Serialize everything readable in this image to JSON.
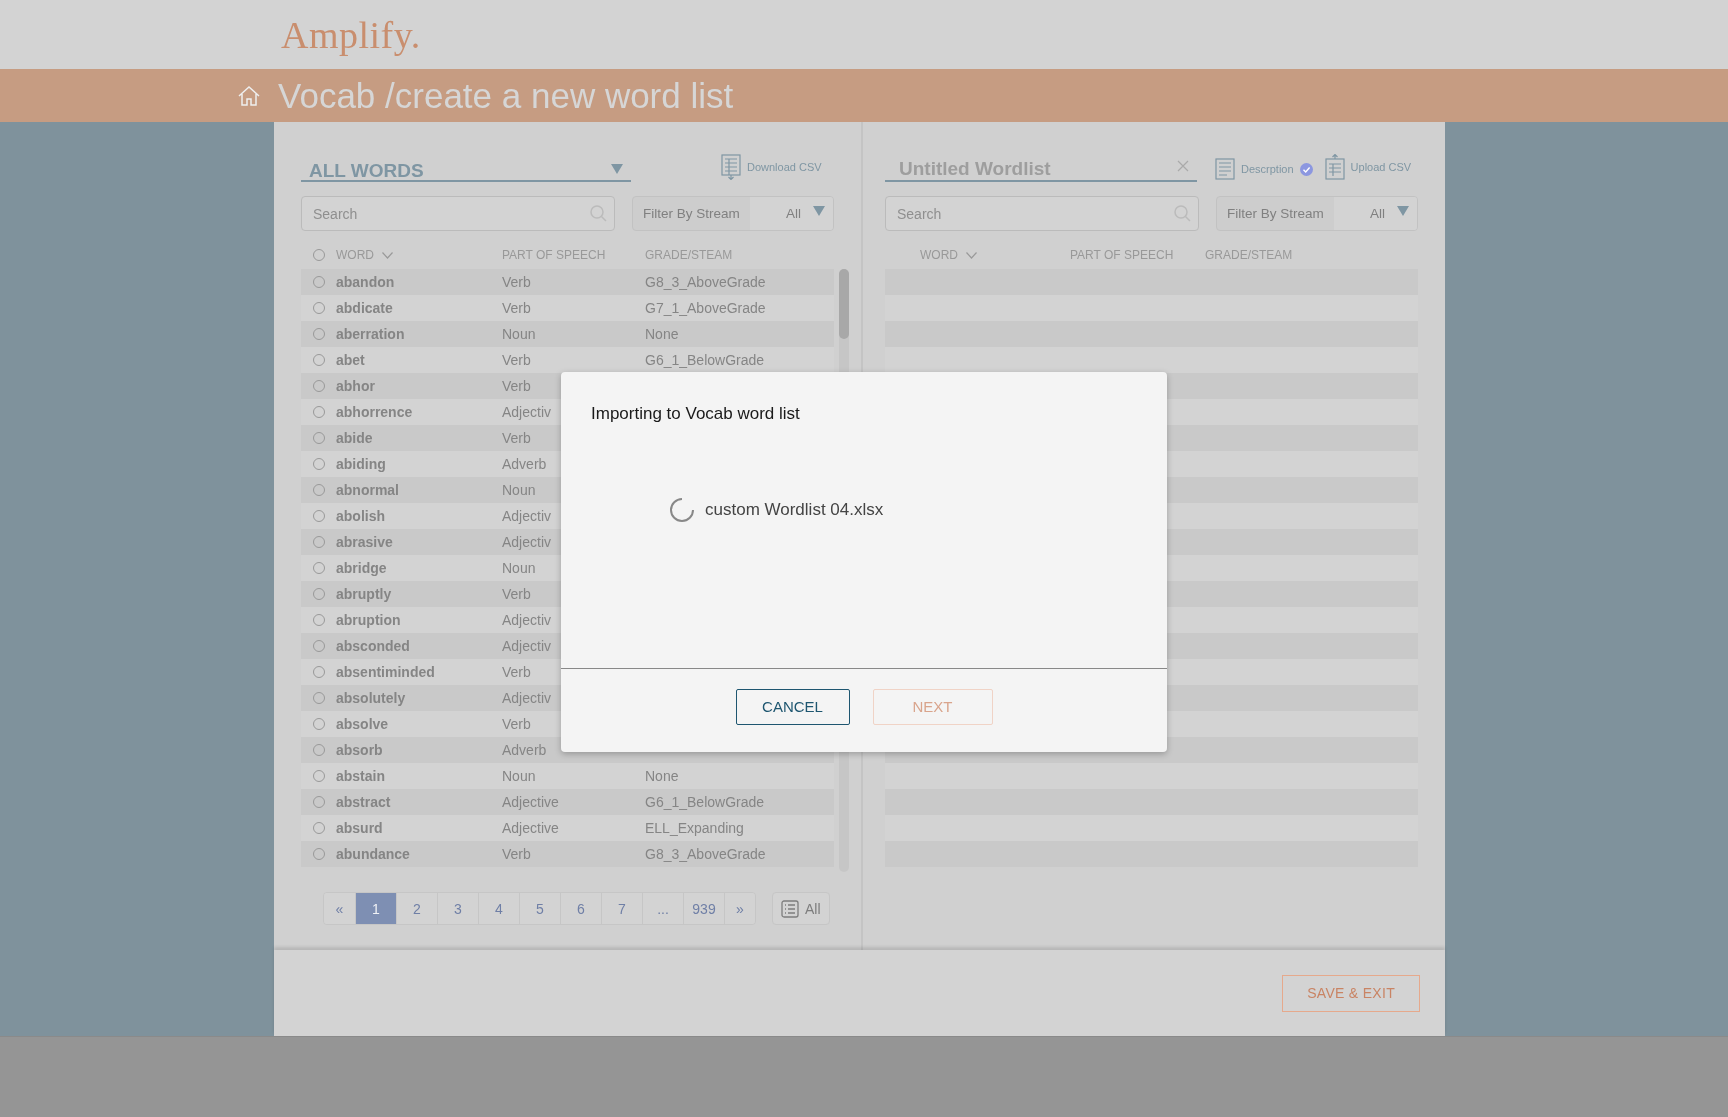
{
  "header": {
    "logo": "Amplify.",
    "breadcrumb": "Vocab /create a new word list"
  },
  "left_panel": {
    "list_selector": "ALL WORDS",
    "download": "Download CSV",
    "search": {
      "placeholder": "Search"
    },
    "filter": {
      "label": "Filter By Stream",
      "value": "All"
    },
    "select_all": {
      "selected": false
    },
    "columns": [
      "WORD",
      "PART OF SPEECH",
      "GRADE/STEAM"
    ],
    "rows": [
      {
        "word": "abandon",
        "part_of_speech": "Verb",
        "grade": "G8_3_AboveGrade",
        "selected": false
      },
      {
        "word": "abdicate",
        "part_of_speech": "Verb",
        "grade": "G7_1_AboveGrade",
        "selected": false
      },
      {
        "word": "aberration",
        "part_of_speech": "Noun",
        "grade": "None",
        "selected": false
      },
      {
        "word": "abet",
        "part_of_speech": "Verb",
        "grade": "G6_1_BelowGrade",
        "selected": false
      },
      {
        "word": "abhor",
        "part_of_speech": "Verb",
        "selected": false
      },
      {
        "word": "abhorrence",
        "part_of_speech": "Adjectiv",
        "selected": false
      },
      {
        "word": "abide",
        "part_of_speech": "Verb",
        "selected": false
      },
      {
        "word": "abiding",
        "part_of_speech": "Adverb",
        "selected": false
      },
      {
        "word": "abnormal",
        "part_of_speech": "Noun",
        "selected": false
      },
      {
        "word": "abolish",
        "part_of_speech": "Adjectiv",
        "selected": false
      },
      {
        "word": "abrasive",
        "part_of_speech": "Adjectiv",
        "selected": false
      },
      {
        "word": "abridge",
        "part_of_speech": "Noun",
        "selected": false
      },
      {
        "word": "abruptly",
        "part_of_speech": "Verb",
        "selected": false
      },
      {
        "word": "abruption",
        "part_of_speech": "Adjectiv",
        "selected": false
      },
      {
        "word": "absconded",
        "part_of_speech": "Adjectiv",
        "selected": false
      },
      {
        "word": "absentiminded",
        "part_of_speech": "Verb",
        "selected": false
      },
      {
        "word": "absolutely",
        "part_of_speech": "Adjectiv",
        "selected": false
      },
      {
        "word": "absolve",
        "part_of_speech": "Verb",
        "selected": false
      },
      {
        "word": "absorb",
        "part_of_speech": "Adverb",
        "selected": false
      },
      {
        "word": "abstain",
        "part_of_speech": "Noun",
        "grade": "None",
        "selected": false
      },
      {
        "word": "abstract",
        "part_of_speech": "Adjective",
        "grade": "G6_1_BelowGrade",
        "selected": false
      },
      {
        "word": "absurd",
        "part_of_speech": "Adjective",
        "grade": "ELL_Expanding",
        "selected": false
      },
      {
        "word": "abundance",
        "part_of_speech": "Verb",
        "grade": "G8_3_AboveGrade",
        "selected": false
      }
    ],
    "pagination": [
      {
        "label": "«",
        "selected": false
      },
      {
        "label": "1",
        "selected": true
      },
      {
        "label": "2",
        "selected": false
      },
      {
        "label": "3",
        "selected": false
      },
      {
        "label": "4",
        "selected": false
      },
      {
        "label": "5",
        "selected": false
      },
      {
        "label": "6",
        "selected": false
      },
      {
        "label": "7",
        "selected": false
      },
      {
        "label": "...",
        "selected": false
      },
      {
        "label": "939",
        "selected": false
      },
      {
        "label": "»",
        "selected": false
      }
    ],
    "view_all": "All"
  },
  "right_panel": {
    "title": {
      "placeholder": "Untitled Wordlist"
    },
    "description": {
      "label": "Descrption",
      "checked": true
    },
    "upload": "Upload CSV",
    "search": {
      "placeholder": "Search"
    },
    "filter": {
      "label": "Filter By Stream",
      "value": "All"
    },
    "columns": [
      "WORD",
      "PART OF SPEECH",
      "GRADE/STEAM"
    ]
  },
  "footer": {
    "save_button": "SAVE & EXIT"
  },
  "modal": {
    "title": "Importing to Vocab word list",
    "file": "custom Wordlist 04.xlsx",
    "buttons": [
      {
        "label": "CANCEL",
        "disabled": false
      },
      {
        "label": "NEXT",
        "disabled": true
      }
    ]
  }
}
